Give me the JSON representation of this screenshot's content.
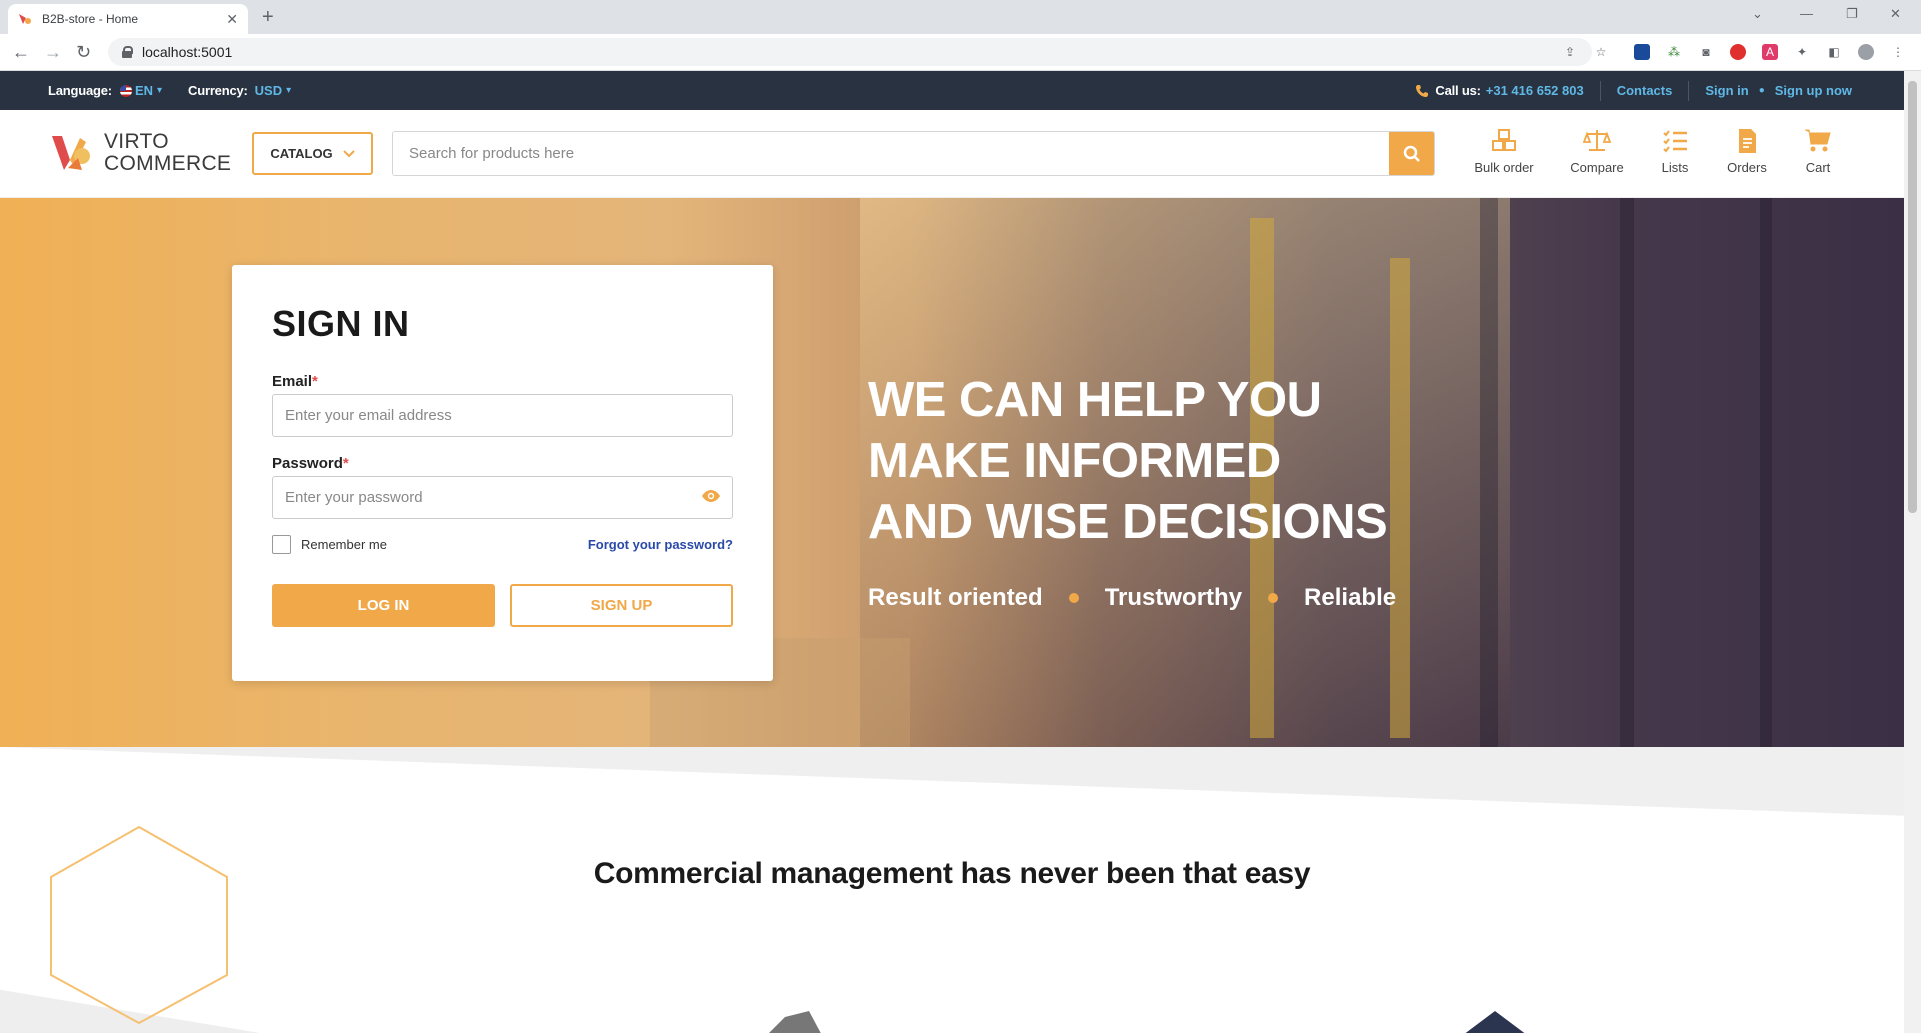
{
  "browser": {
    "tab_title": "B2B-store - Home",
    "url": "localhost:5001"
  },
  "topbar": {
    "language_label": "Language:",
    "language_value": "EN",
    "currency_label": "Currency:",
    "currency_value": "USD",
    "call_label": "Call us:",
    "phone": "+31 416 652 803",
    "contacts": "Contacts",
    "sign_in": "Sign in",
    "sign_up": "Sign up now"
  },
  "header": {
    "logo_line1": "VIRTO",
    "logo_line2": "COMMERCE",
    "catalog": "CATALOG",
    "search_placeholder": "Search for products here",
    "icons": [
      {
        "label": "Bulk order",
        "icon": "boxes-icon"
      },
      {
        "label": "Compare",
        "icon": "scales-icon"
      },
      {
        "label": "Lists",
        "icon": "checklist-icon"
      },
      {
        "label": "Orders",
        "icon": "document-icon"
      },
      {
        "label": "Cart",
        "icon": "cart-icon"
      }
    ]
  },
  "signin": {
    "title": "SIGN IN",
    "email_label": "Email",
    "email_placeholder": "Enter your email address",
    "password_label": "Password",
    "password_placeholder": "Enter your password",
    "remember": "Remember me",
    "forgot": "Forgot your password?",
    "login_button": "LOG IN",
    "signup_button": "SIGN UP",
    "required_mark": "*"
  },
  "hero": {
    "lines": [
      "WE CAN HELP YOU",
      "MAKE INFORMED",
      "AND WISE DECISIONS"
    ],
    "features": [
      "Result oriented",
      "Trustworthy",
      "Reliable"
    ]
  },
  "section": {
    "heading": "Commercial management has never been that easy"
  },
  "colors": {
    "accent": "#f0a848",
    "topbar_bg": "#293241",
    "link": "#5fb8e6"
  }
}
